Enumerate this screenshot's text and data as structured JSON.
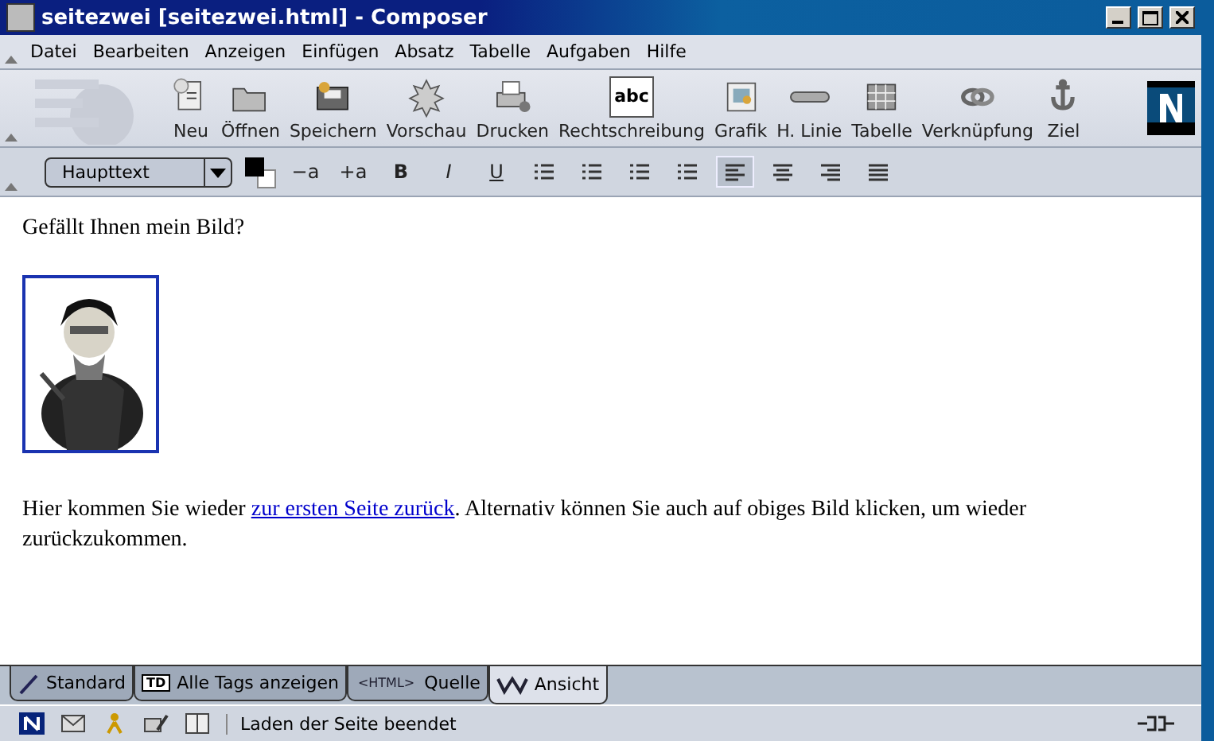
{
  "window": {
    "title": "seitezwei [seitezwei.html] - Composer"
  },
  "menu": [
    "Datei",
    "Bearbeiten",
    "Anzeigen",
    "Einfügen",
    "Absatz",
    "Tabelle",
    "Aufgaben",
    "Hilfe"
  ],
  "toolbar": [
    {
      "label": "Neu"
    },
    {
      "label": "Öffnen"
    },
    {
      "label": "Speichern"
    },
    {
      "label": "Vorschau"
    },
    {
      "label": "Drucken"
    },
    {
      "label": "Rechtschreibung",
      "icon_text": "abc"
    },
    {
      "label": "Grafik"
    },
    {
      "label": "H. Linie"
    },
    {
      "label": "Tabelle"
    },
    {
      "label": "Verknüpfung"
    },
    {
      "label": "Ziel"
    }
  ],
  "format_bar": {
    "paragraph_style": "Haupttext",
    "text_buttons": [
      "−a",
      "+a",
      "B",
      "I",
      "U"
    ],
    "align": [
      {
        "selected": true
      },
      {
        "selected": false
      },
      {
        "selected": false
      },
      {
        "selected": false
      }
    ]
  },
  "document": {
    "heading": "Gefällt Ihnen mein Bild?",
    "paragraph": [
      {
        "kind": "text",
        "text": "Hier kommen Sie wieder "
      },
      {
        "kind": "link",
        "text": "zur ersten Seite zurück"
      },
      {
        "kind": "text",
        "text": ". Alternativ können Sie auch auf obiges Bild klicken, um wieder zurückzukommen."
      }
    ]
  },
  "mode_tabs": [
    {
      "label": "Standard",
      "selected": false
    },
    {
      "label": "Alle Tags anzeigen",
      "icon_text": "TD",
      "selected": false
    },
    {
      "label": "Quelle",
      "icon_text": "<HTML>",
      "selected": false
    },
    {
      "label": "Ansicht",
      "selected": true
    }
  ],
  "status_bar": {
    "text": "Laden der Seite beendet"
  }
}
